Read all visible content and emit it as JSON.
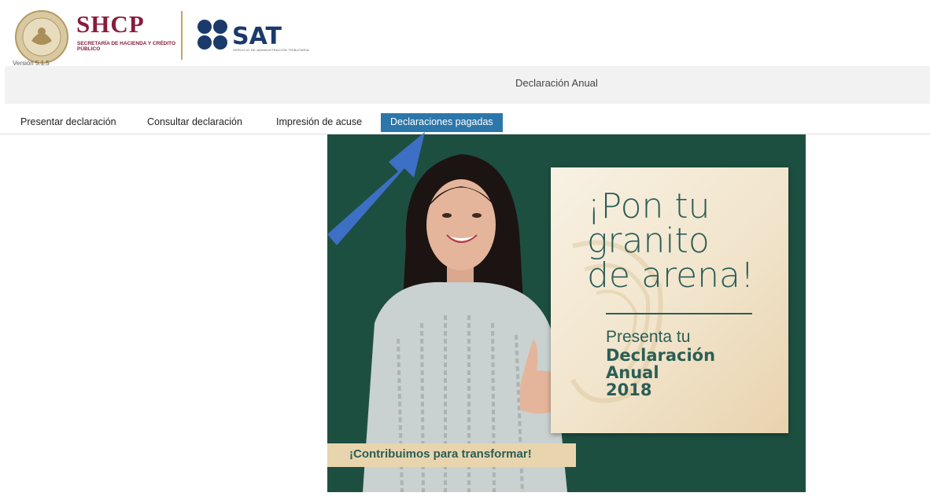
{
  "header": {
    "shcp_title": "SHCP",
    "shcp_subtitle": "SECRETARÍA DE HACIENDA Y CRÉDITO PÚBLICO",
    "version": "Versión 5.1.5",
    "sat_title": "SAT",
    "sat_subtitle": "SERVICIO DE ADMINISTRACIÓN TRIBUTARIA"
  },
  "band": {
    "title": "Declaración Anual"
  },
  "nav": {
    "tabs": [
      {
        "label": "Presentar declaración",
        "active": false
      },
      {
        "label": "Consultar declaración",
        "active": false
      },
      {
        "label": "Impresión de acuse",
        "active": false
      },
      {
        "label": "Declaraciones pagadas",
        "active": true
      }
    ]
  },
  "banner": {
    "headline_1": "¡Pon tu",
    "headline_2": "granito",
    "headline_3": "de arena!",
    "present": "Presenta tu",
    "declaracion_1": "Declaración",
    "declaracion_2": "Anual",
    "declaracion_3": "2018",
    "slogan": "¡Contribuimos para transformar!"
  },
  "colors": {
    "shcp": "#8a1c3b",
    "sat": "#1a3a6b",
    "active_tab": "#2c77a9",
    "banner_bg": "#1d4f41",
    "arrow": "#3d6fc4"
  }
}
